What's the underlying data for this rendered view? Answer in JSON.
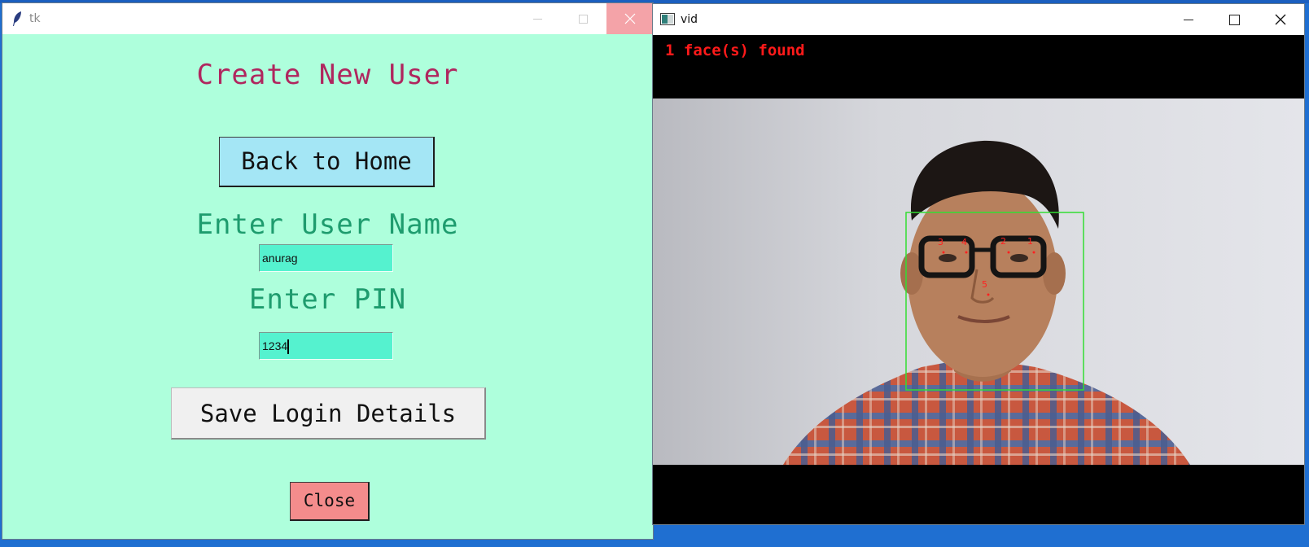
{
  "tk_window": {
    "title": "tk",
    "heading": "Create New User",
    "back_button": "Back to Home",
    "username_label": "Enter User Name",
    "username_value": "anurag",
    "pin_label": "Enter PIN",
    "pin_value": "1234",
    "save_button": "Save Login Details",
    "close_button": "Close"
  },
  "vid_window": {
    "title": "vid",
    "overlay_text": "1 face(s) found",
    "landmark_labels": [
      "1",
      "2",
      "3",
      "4",
      "5"
    ]
  },
  "colors": {
    "tk_background": "#aeffdc",
    "heading": "#b0265e",
    "labels": "#1e9c6e",
    "input_background": "#55f2cf",
    "back_button": "#a4e6f5",
    "close_button": "#f48c8c",
    "face_box": "#33dd33",
    "overlay_text": "#ff1a1a"
  }
}
